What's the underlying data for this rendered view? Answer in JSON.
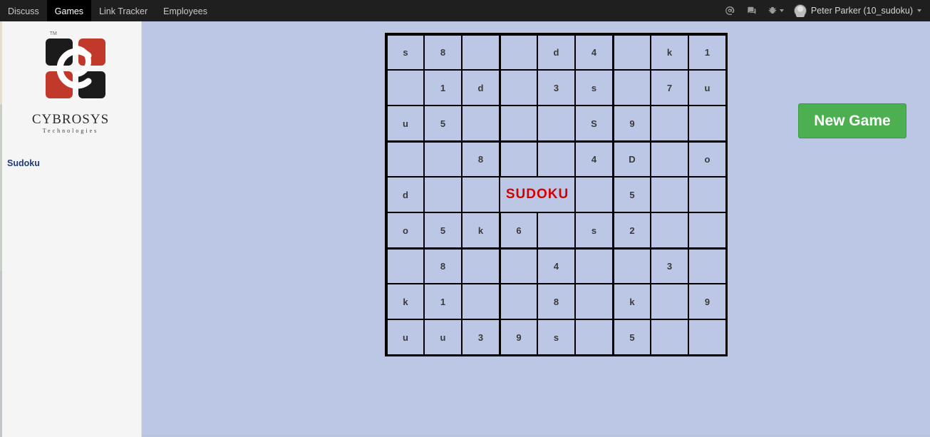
{
  "nav": {
    "items": [
      "Discuss",
      "Games",
      "Link Tracker",
      "Employees"
    ],
    "active_index": 1,
    "user_label": "Peter Parker (10_sudoku)"
  },
  "sidebar": {
    "brand_line1": "CYBROSYS",
    "brand_line2": "Technologies",
    "tm": "TM",
    "link": "Sudoku"
  },
  "game": {
    "title": "SUDOKU",
    "new_game_label": "New Game",
    "grid": [
      [
        "s",
        "8",
        "",
        "",
        "d",
        "4",
        "",
        "k",
        "1"
      ],
      [
        "",
        "1",
        "d",
        "",
        "3",
        "s",
        "",
        "7",
        "u"
      ],
      [
        "u",
        "5",
        "",
        "",
        "",
        "S",
        "9",
        "",
        ""
      ],
      [
        "",
        "",
        "8",
        "",
        "",
        "4",
        "D",
        "",
        "o"
      ],
      [
        "d",
        "",
        "",
        "",
        "",
        "",
        "5",
        "",
        ""
      ],
      [
        "o",
        "5",
        "k",
        "6",
        "",
        "s",
        "2",
        "",
        ""
      ],
      [
        "",
        "8",
        "",
        "",
        "4",
        "",
        "",
        "3",
        ""
      ],
      [
        "k",
        "1",
        "",
        "",
        "8",
        "",
        "k",
        "",
        "9"
      ],
      [
        "u",
        "u",
        "3",
        "9",
        "s",
        "",
        "5",
        "",
        ""
      ]
    ]
  }
}
